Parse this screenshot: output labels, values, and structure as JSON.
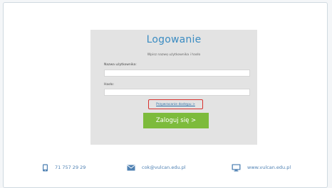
{
  "login": {
    "title": "Logowanie",
    "subtitle": "Wpisz nazwę użytkownika i hasło",
    "username_label": "Nazwa użytkownika:",
    "username_value": "",
    "password_label": "Hasło:",
    "password_value": "",
    "recover_link": "Przywracanie dostępu >",
    "submit_label": "Zaloguj się >"
  },
  "footer": {
    "phone": "71 757 29 29",
    "email": "cok@vulcan.edu.pl",
    "website": "www.vulcan.edu.pl"
  },
  "icons": {
    "phone": "phone-icon",
    "email": "envelope-icon",
    "website": "monitor-icon"
  },
  "colors": {
    "accent": "#3b8cc2",
    "button": "#7dbb3c",
    "highlight_border": "#d9322e",
    "footer_text": "#4f81b3"
  }
}
